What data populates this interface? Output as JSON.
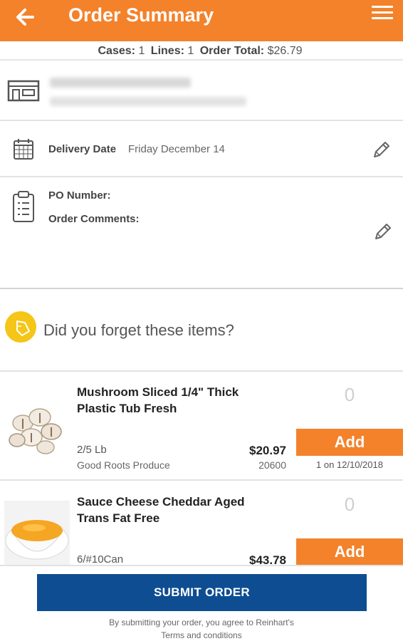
{
  "header": {
    "title": "Order Summary",
    "back_icon": "back-arrow-icon",
    "menu_icon": "hamburger-menu-icon",
    "color": "#F3822B"
  },
  "summary": {
    "cases_label": "Cases:",
    "cases_value": "1",
    "lines_label": "Lines:",
    "lines_value": "1",
    "total_label": "Order Total:",
    "total_value": "$26.79"
  },
  "delivery": {
    "label": "Delivery Date",
    "value": "Friday December 14"
  },
  "po": {
    "po_label": "PO Number:",
    "comments_label": "Order Comments:"
  },
  "suggestions": {
    "heading": "Did you forget these items?"
  },
  "items": [
    {
      "name": "Mushroom Sliced 1/4\" Thick Plastic Tub Fresh",
      "pack": "2/5 Lb",
      "vendor": "Good Roots Produce",
      "price": "$20.97",
      "code": "20600",
      "quantity": "0",
      "add_label": "Add",
      "last_ordered": "1 on 12/10/2018"
    },
    {
      "name": "Sauce Cheese Cheddar Aged Trans Fat Free",
      "pack": "6/#10Can",
      "price": "$43.78",
      "quantity": "0",
      "add_label": "Add"
    }
  ],
  "footer": {
    "submit_label": "SUBMIT ORDER",
    "terms_line1": "By submitting your order, you agree to Reinhart's",
    "terms_line2": "Terms and conditions",
    "submit_color": "#0E4D92"
  }
}
